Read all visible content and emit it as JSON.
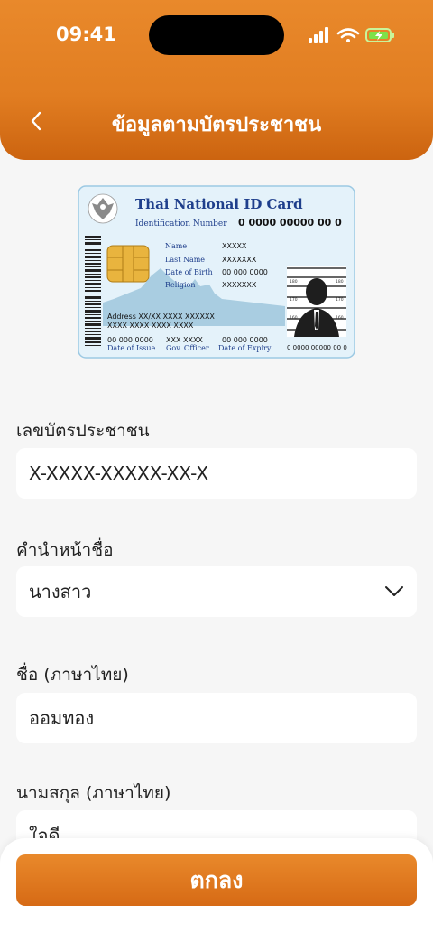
{
  "status": {
    "time": "09:41"
  },
  "header": {
    "title": "ข้อมูลตามบัตรประชาชน",
    "back_icon": "chevron-left-icon"
  },
  "id_card": {
    "title": "Thai National ID Card",
    "id_label": "Identification Number",
    "id_value": "0 0000 00000 00 0",
    "name_label": "Name",
    "name_value": "XXXXX",
    "lastname_label": "Last Name",
    "lastname_value": "XXXXXXX",
    "dob_label": "Date of Birth",
    "dob_value": "00 000 0000",
    "religion_label": "Religion",
    "religion_value": "XXXXXXX",
    "address_line1": "Address XX/XX XXXX XXXXXX",
    "address_line2": "XXXX XXXX XXXX XXXX",
    "issue_value": "00 000 0000",
    "issue_label": "Date of Issue",
    "officer_value": "XXX XXXX",
    "officer_label": "Gov. Officer",
    "expiry_value": "00 000 0000",
    "expiry_label": "Date of Expiry",
    "photo_id": "0 0000 00000 00 0",
    "height_marks": [
      "180",
      "170",
      "160",
      "180",
      "170",
      "160"
    ]
  },
  "form": {
    "id_label": "เลขบัตรประชาชน",
    "id_value": "X-XXXX-XXXXX-XX-X",
    "prefix_label": "คำนำหน้าชื่อ",
    "prefix_value": "นางสาว",
    "firstname_label": "ชื่อ (ภาษาไทย)",
    "firstname_value": "ออมทอง",
    "lastname_label": "นามสกุล (ภาษาไทย)",
    "lastname_value": "ใจดี"
  },
  "footer": {
    "submit_label": "ตกลง"
  },
  "colors": {
    "accent": "#e17d21",
    "accent_dark": "#cc6410",
    "background": "#f6f6f6",
    "card_blue": "#d9ecf7"
  }
}
